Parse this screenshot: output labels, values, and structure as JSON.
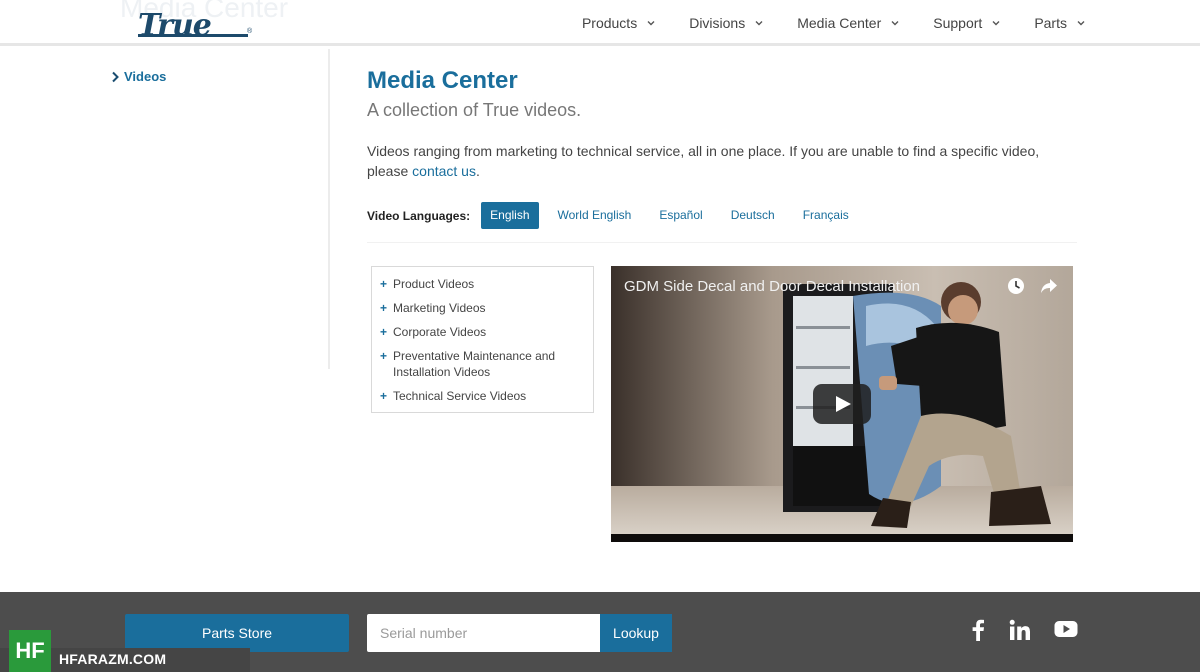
{
  "header": {
    "ghost_title": "Media Center",
    "logo_text": "True",
    "logo_reg": "®",
    "nav": [
      {
        "label": "Products"
      },
      {
        "label": "Divisions"
      },
      {
        "label": "Media Center"
      },
      {
        "label": "Support"
      },
      {
        "label": "Parts"
      }
    ]
  },
  "sidebar": {
    "items": [
      {
        "label": "Videos"
      }
    ]
  },
  "main": {
    "title": "Media Center",
    "subtitle": "A collection of True videos.",
    "intro_text": "Videos ranging from marketing to technical service, all in one place. If you are unable to find a specific video, please ",
    "intro_link": "contact us",
    "intro_end": ".",
    "languages_label": "Video Languages:",
    "languages": [
      {
        "label": "English",
        "active": true
      },
      {
        "label": "World English",
        "active": false
      },
      {
        "label": "Español",
        "active": false
      },
      {
        "label": "Deutsch",
        "active": false
      },
      {
        "label": "Français",
        "active": false
      }
    ],
    "categories": [
      {
        "label": "Product Videos"
      },
      {
        "label": "Marketing Videos"
      },
      {
        "label": "Corporate Videos"
      },
      {
        "label": "Preventative Maintenance and Installation Videos"
      },
      {
        "label": "Technical Service Videos"
      }
    ],
    "video": {
      "title": "GDM Side Decal and Door Decal Installation",
      "icons": [
        "clock-icon",
        "share-icon",
        "play-icon"
      ]
    }
  },
  "footer": {
    "parts_store": "Parts Store",
    "serial_placeholder": "Serial number",
    "lookup": "Lookup",
    "social": [
      "facebook-icon",
      "linkedin-icon",
      "youtube-icon"
    ]
  },
  "watermark": {
    "badge": "HF",
    "text": "HFARAZM.COM"
  },
  "colors": {
    "accent": "#1a6e9c",
    "footer_bg": "#4d4d4d",
    "logo": "#1d4a6b"
  }
}
